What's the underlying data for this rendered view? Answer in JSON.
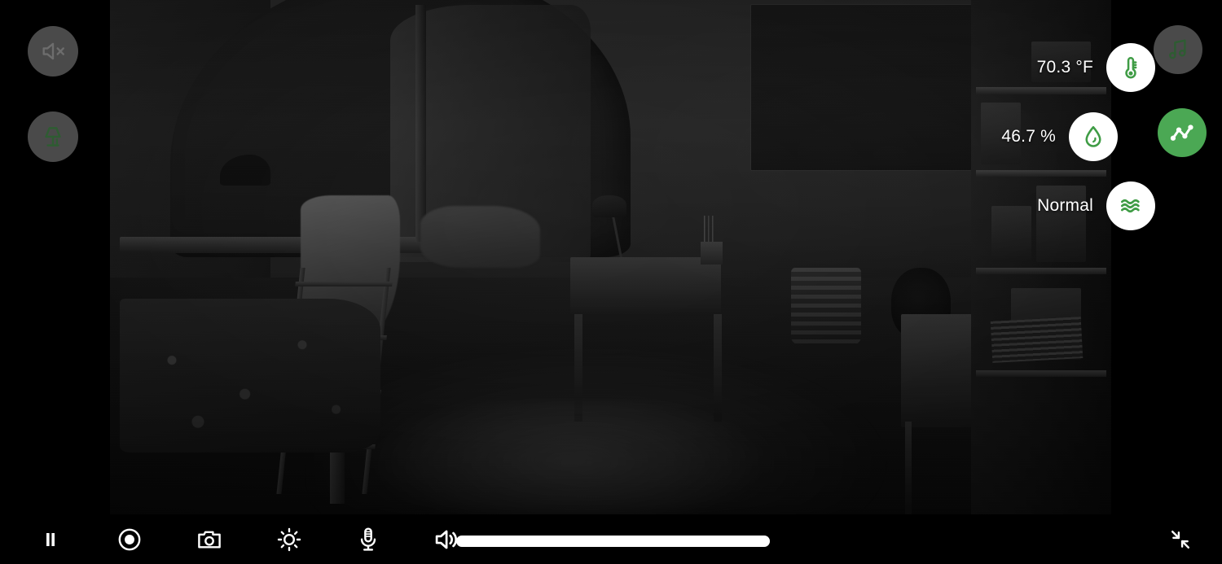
{
  "app": {
    "title": "Baby Monitor Live View",
    "mode": "fullscreen-landscape",
    "accent_green": "#4BA854",
    "disabled_gray": "#4A4A4A",
    "panel_black": "#000000"
  },
  "video": {
    "description": "Night-vision camera feed of a child's bedroom",
    "night_vision": true,
    "state": "live"
  },
  "left_controls": [
    {
      "name": "mute-alerts-button",
      "icon": "speaker-mute-icon",
      "state": "disabled",
      "label": "Sound alerts off"
    },
    {
      "name": "nightlight-button",
      "icon": "lamp-icon",
      "state": "disabled",
      "label": "Night light"
    }
  ],
  "sensors": [
    {
      "name": "temperature",
      "value": "70.3 °F",
      "icon": "thermometer-icon"
    },
    {
      "name": "humidity",
      "value": "46.7 %",
      "icon": "water-drop-icon"
    },
    {
      "name": "air-quality",
      "value": "Normal",
      "icon": "air-waves-icon"
    }
  ],
  "right_actions": [
    {
      "name": "lullaby-button",
      "icon": "music-note-icon",
      "state": "disabled"
    },
    {
      "name": "history-button",
      "icon": "line-chart-icon",
      "state": "active"
    }
  ],
  "toolbar": {
    "pause": {
      "label": "Pause",
      "icon": "pause-icon"
    },
    "record": {
      "label": "Record",
      "icon": "record-icon"
    },
    "snapshot": {
      "label": "Snapshot",
      "icon": "camera-icon"
    },
    "brightness": {
      "label": "Brightness",
      "icon": "brightness-sun-icon"
    },
    "microphone": {
      "label": "Talk",
      "icon": "microphone-icon"
    },
    "speaker": {
      "label": "Volume",
      "icon": "speaker-on-icon"
    },
    "exit_fullscreen": {
      "label": "Exit full screen",
      "icon": "collapse-arrows-icon"
    },
    "volume": {
      "value": 100,
      "min": 0,
      "max": 100
    }
  }
}
